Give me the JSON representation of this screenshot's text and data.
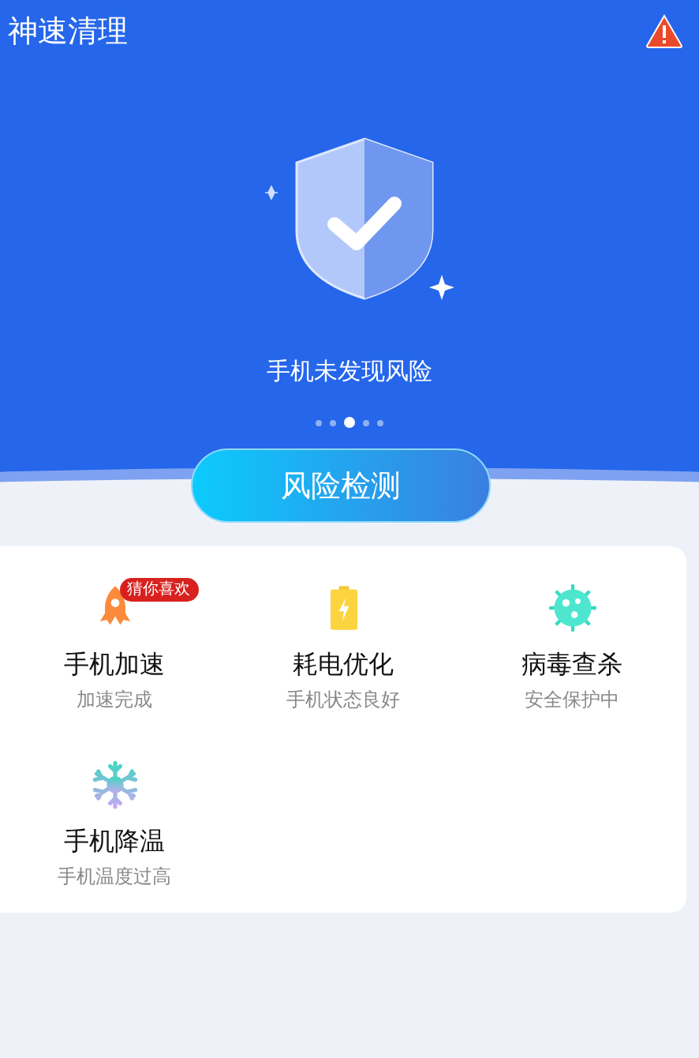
{
  "app_title": "神速清理",
  "status": "手机未发现风险",
  "page_dots": [
    {
      "selected": false
    },
    {
      "selected": false
    },
    {
      "selected": true
    },
    {
      "selected": false
    },
    {
      "selected": false
    }
  ],
  "scan_button": "风险检测",
  "features": [
    {
      "kind": "rocket",
      "title": "手机加速",
      "subtitle": "加速完成",
      "badge": "猜你喜欢"
    },
    {
      "kind": "battery",
      "title": "耗电优化",
      "subtitle": "手机状态良好"
    },
    {
      "kind": "virus",
      "title": "病毒查杀",
      "subtitle": "安全保护中"
    },
    {
      "kind": "snowflake",
      "title": "手机降温",
      "subtitle": "手机温度过高"
    }
  ]
}
